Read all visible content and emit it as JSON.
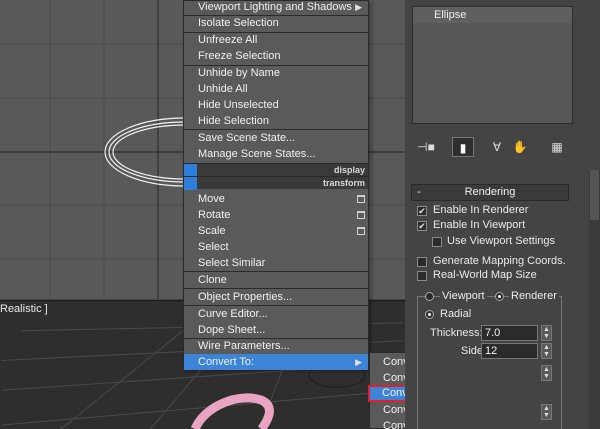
{
  "viewport": {
    "label": "Realistic ]"
  },
  "quad_menu": {
    "items_top": [
      "Viewport Lighting and Shadows",
      "Isolate Selection",
      "Unfreeze All",
      "Freeze Selection",
      "Unhide by Name",
      "Unhide All",
      "Hide Unselected",
      "Hide Selection",
      "Save Scene State...",
      "Manage Scene States..."
    ],
    "display_label": "display",
    "transform_label": "transform",
    "items_bottom": [
      "Move",
      "Rotate",
      "Scale",
      "Select",
      "Select Similar",
      "Clone",
      "Object Properties...",
      "Curve Editor...",
      "Dope Sheet...",
      "Wire Parameters...",
      "Convert To:"
    ]
  },
  "submenu": {
    "items": [
      "Convert to Editable Spline",
      "Convert to Editable Mesh",
      "Convert to Editable Poly",
      "Convert to Deformable gPoly",
      "Convert to Editable Patch"
    ],
    "highlighted_index": 2
  },
  "modifier_stack": {
    "items": [
      "Ellipse"
    ]
  },
  "toolbar": {
    "icons": [
      "pin-stack-icon",
      "show-end-result-icon",
      "make-unique-icon",
      "remove-modifier-icon",
      "configure-sets-icon"
    ]
  },
  "rendering_rollout": {
    "minus": "-",
    "title": "Rendering",
    "enable_in_renderer": {
      "label": "Enable In Renderer",
      "checked": true
    },
    "enable_in_viewport": {
      "label": "Enable In Viewport",
      "checked": true
    },
    "use_viewport_settings": {
      "label": "Use Viewport Settings",
      "checked": false
    },
    "generate_mapping": {
      "label": "Generate Mapping Coords.",
      "checked": false
    },
    "real_world_map": {
      "label": "Real-World Map Size",
      "checked": false
    },
    "radio_viewport": "Viewport",
    "radio_renderer": "Renderer",
    "radio_radial": "Radial",
    "thickness_label": "Thickness:",
    "thickness_value": "7.0",
    "sides_label": "Sides:",
    "sides_value": "12"
  },
  "colors": {
    "menu_bg": "#5a5a5a",
    "highlight": "#3c84d6",
    "red_outline": "#e0202e",
    "viewport_bg": "#595959"
  }
}
